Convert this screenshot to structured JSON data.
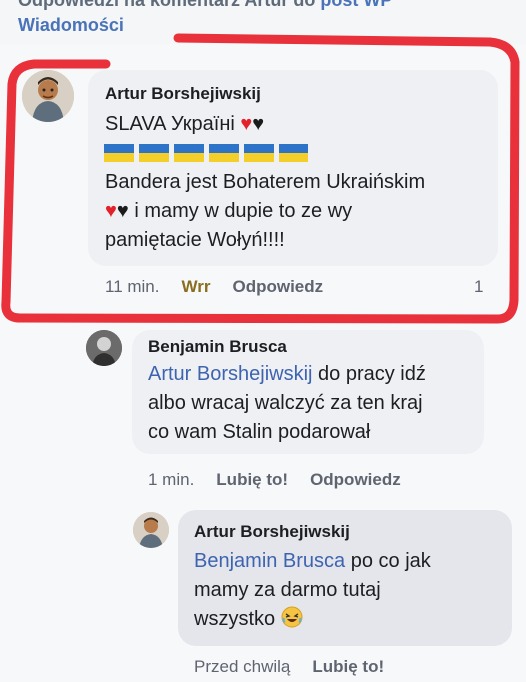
{
  "header": {
    "crumb_prefix": "Odpowiedzi na komentarz Artur do ",
    "crumb_link": "post WP",
    "source": "Wiadomości"
  },
  "comments": [
    {
      "author": "Artur Borshejiwskij",
      "line1": "SLAVA Україні",
      "line1_icons": [
        "red-heart-icon",
        "black-heart-icon"
      ],
      "flag_icon": "ukraine-flag-icon",
      "line3": "Bandera jest Bohaterem Ukraińskim",
      "line4": "i mamy w dupie to ze wy",
      "line4_icons": [
        "red-heart-icon",
        "black-heart-icon"
      ],
      "line5": "pamiętacie Wołyń!!!!",
      "time": "11 min.",
      "reaction": "Wrr",
      "reply": "Odpowiedz",
      "count": "1"
    },
    {
      "author": "Benjamin Brusca",
      "mention": "Artur Borshejiwskij",
      "text_after_mention": " do pracy idź",
      "line2": "albo wracaj walczyć za ten kraj",
      "line3": "co wam Stalin podarował",
      "time": "1 min.",
      "like": "Lubię to!",
      "reply": "Odpowiedz"
    },
    {
      "author": "Artur Borshejiwskij",
      "mention": "Benjamin Brusca",
      "text_after_mention": " po co jak",
      "line2": "mamy za darmo tutaj",
      "line3": "wszystko",
      "line3_icon": "laughing-emoji-icon",
      "time": "Przed chwilą",
      "like": "Lubię to!"
    }
  ],
  "colors": {
    "highlight": "#e8313a",
    "link": "#3e64b0",
    "bubble": "#eef0f4",
    "bubble_dark": "#e4e6ec"
  }
}
